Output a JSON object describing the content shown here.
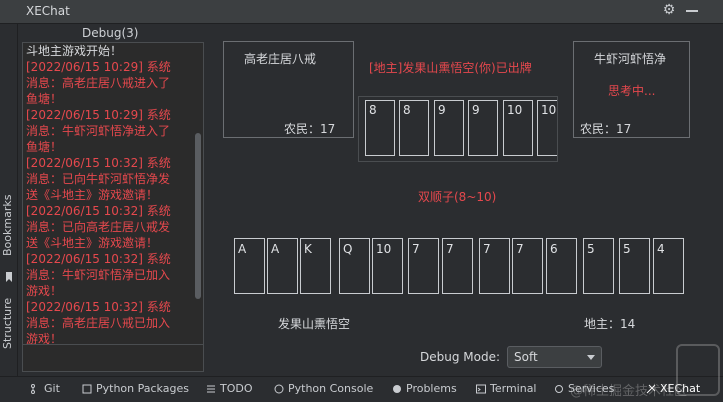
{
  "window": {
    "title": "XEChat"
  },
  "sidebar_left": {
    "bookmarks": "Bookmarks",
    "structure": "Structure"
  },
  "chat": {
    "tab": "Debug(3)",
    "lines": [
      "斗地主游戏开始！",
      "[2022/06/15 10:29] 系统",
      "消息：高老庄居八戒进入了",
      "鱼塘！",
      "[2022/06/15 10:29] 系统",
      "消息：牛虾河虾悟净进入了",
      "鱼塘！",
      "[2022/06/15 10:32] 系统",
      "消息：已向牛虾河虾悟净发",
      "送《斗地主》游戏邀请！",
      "[2022/06/15 10:32] 系统",
      "消息：已向高老庄居八戒发",
      "送《斗地主》游戏邀请！",
      "[2022/06/15 10:32] 系统",
      "消息：牛虾河虾悟净已加入",
      "游戏！",
      "[2022/06/15 10:32] 系统",
      "消息：高老庄居八戒已加入",
      "游戏！"
    ]
  },
  "game": {
    "left_player": {
      "name": "高老庄居八戒",
      "role": "农民：17"
    },
    "right_player": {
      "name": "牛虾河虾悟净",
      "status": "思考中...",
      "role": "农民：17"
    },
    "last_play_message": "[地主]发果山熏悟空(你)已出牌",
    "played_cards": [
      "8",
      "8",
      "9",
      "9",
      "10",
      "10"
    ],
    "hand_type": "双顺子(8~10)",
    "hand_cards": [
      "A",
      "A",
      "K",
      "Q",
      "10",
      "7",
      "7",
      "7",
      "7",
      "6",
      "5",
      "5",
      "4"
    ],
    "self": {
      "name": "发果山熏悟空",
      "role": "地主：14"
    }
  },
  "debug_mode": {
    "label": "Debug Mode:",
    "value": "Soft"
  },
  "bottom_tabs": [
    {
      "label": "Git",
      "icon": "git-branch-icon"
    },
    {
      "label": "Python Packages",
      "icon": "packages-icon"
    },
    {
      "label": "TODO",
      "icon": "todo-list-icon"
    },
    {
      "label": "Python Console",
      "icon": "python-console-icon"
    },
    {
      "label": "Problems",
      "icon": "problems-icon"
    },
    {
      "label": "Terminal",
      "icon": "terminal-icon"
    },
    {
      "label": "Services",
      "icon": "services-icon"
    },
    {
      "label": "XEChat",
      "icon": "xechat-icon"
    }
  ],
  "watermark": "@稀土掘金技术社区",
  "colors": {
    "accent_red": "#e5484d",
    "background": "#2b2d30"
  }
}
